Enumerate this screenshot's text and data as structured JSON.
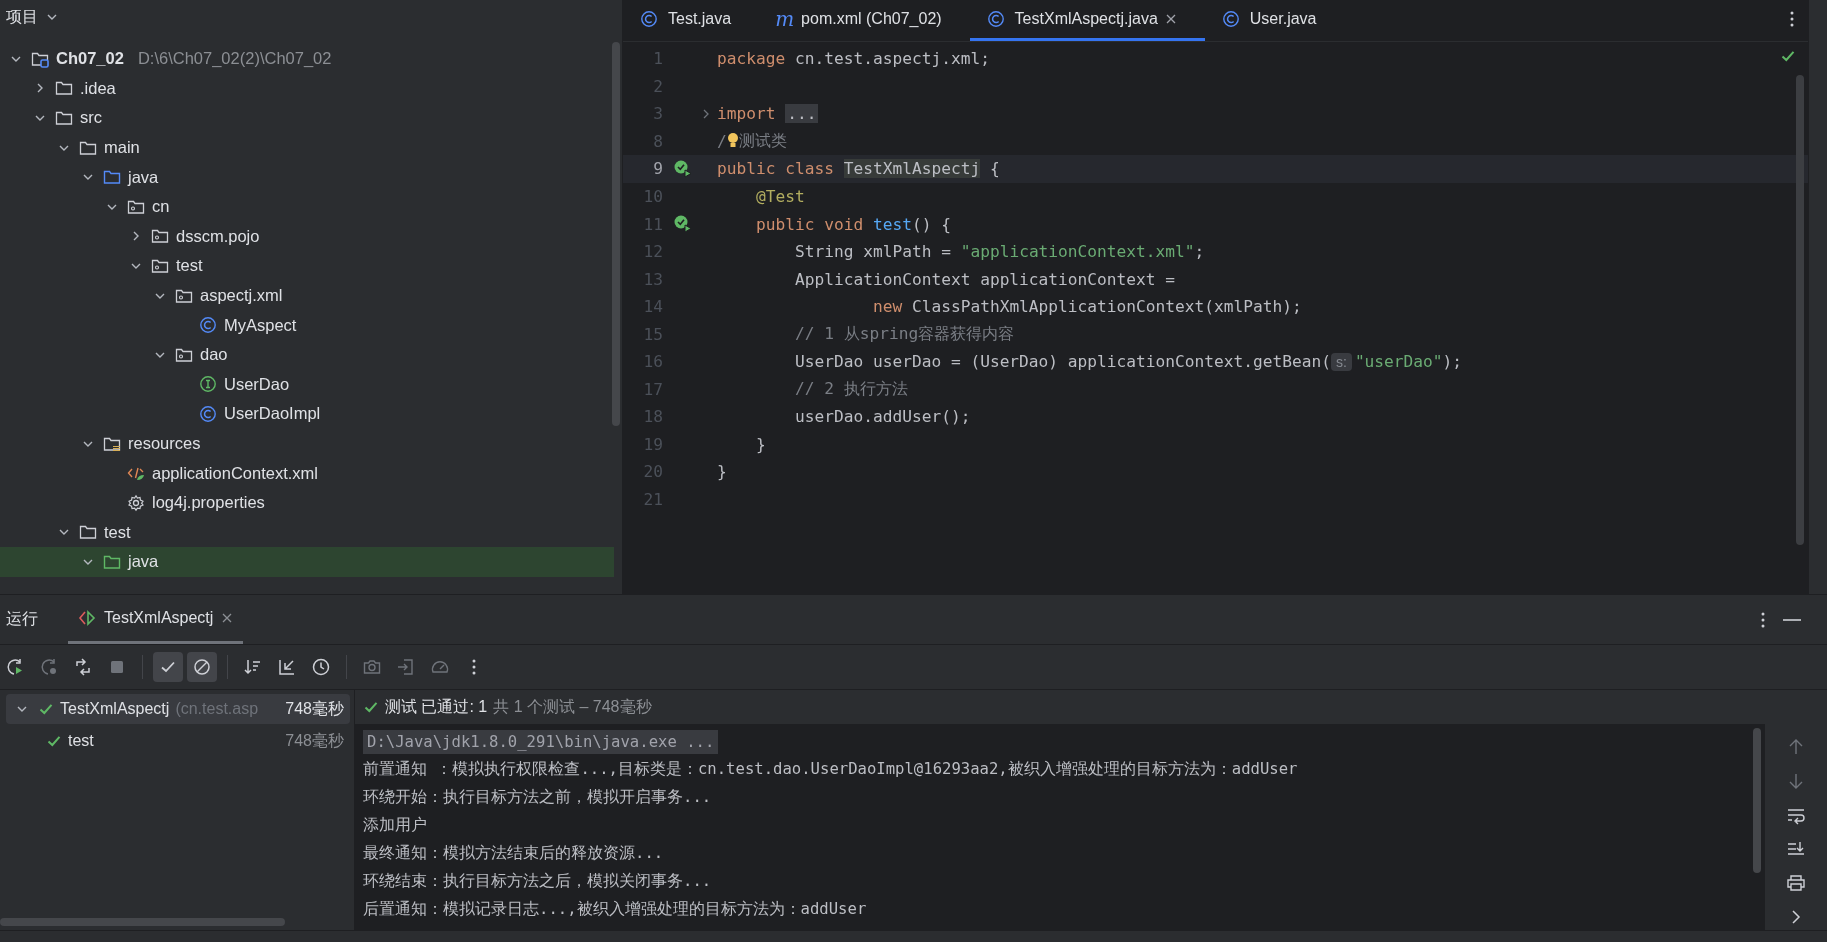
{
  "project_panel": {
    "title": "项目",
    "tree": [
      {
        "name": "Ch07_02",
        "path": "D:\\6\\Ch07_02(2)\\Ch07_02",
        "kind": "module",
        "expanded": true,
        "selected": false,
        "children": [
          {
            "name": ".idea",
            "kind": "folder",
            "expanded": false,
            "selected": false
          },
          {
            "name": "src",
            "kind": "folder",
            "expanded": true,
            "selected": false,
            "children": [
              {
                "name": "main",
                "kind": "folder",
                "expanded": true,
                "selected": false,
                "children": [
                  {
                    "name": "java",
                    "kind": "source",
                    "expanded": true,
                    "selected": false,
                    "children": [
                      {
                        "name": "cn",
                        "kind": "package",
                        "expanded": true,
                        "selected": false,
                        "children": [
                          {
                            "name": "dsscm.pojo",
                            "kind": "package",
                            "expanded": false,
                            "selected": false
                          },
                          {
                            "name": "test",
                            "kind": "package",
                            "expanded": true,
                            "selected": false,
                            "children": [
                              {
                                "name": "aspectj.xml",
                                "kind": "package",
                                "expanded": true,
                                "selected": false,
                                "children": [
                                  {
                                    "name": "MyAspect",
                                    "kind": "class",
                                    "selected": false
                                  }
                                ]
                              },
                              {
                                "name": "dao",
                                "kind": "package",
                                "expanded": true,
                                "selected": false,
                                "children": [
                                  {
                                    "name": "UserDao",
                                    "kind": "interface",
                                    "selected": false
                                  },
                                  {
                                    "name": "UserDaoImpl",
                                    "kind": "class",
                                    "selected": false
                                  }
                                ]
                              }
                            ]
                          }
                        ]
                      }
                    ]
                  },
                  {
                    "name": "resources",
                    "kind": "resources",
                    "expanded": true,
                    "selected": false,
                    "children": [
                      {
                        "name": "applicationContext.xml",
                        "kind": "xml",
                        "selected": false
                      },
                      {
                        "name": "log4j.properties",
                        "kind": "properties",
                        "selected": false
                      }
                    ]
                  }
                ]
              },
              {
                "name": "test",
                "kind": "folder",
                "expanded": true,
                "selected": false,
                "children": [
                  {
                    "name": "java",
                    "kind": "test-source",
                    "expanded": true,
                    "selected": true
                  }
                ]
              }
            ]
          }
        ]
      }
    ]
  },
  "editor": {
    "tabs": [
      {
        "label": "Test.java",
        "kind": "class",
        "selected": false
      },
      {
        "label": "pom.xml (Ch07_02)",
        "kind": "maven",
        "glyph": "m",
        "selected": false
      },
      {
        "label": "TestXmlAspectj.java",
        "kind": "class",
        "selected": true
      },
      {
        "label": "User.java",
        "kind": "class",
        "selected": false
      }
    ],
    "lines": [
      {
        "number": "1",
        "current": false,
        "kind": "code",
        "tokens": [
          {
            "text": "package",
            "kind": "keyword"
          },
          {
            "text": " cn.test.aspectj.xml;",
            "kind": "plain"
          }
        ]
      },
      {
        "number": "2",
        "current": false,
        "kind": "code"
      },
      {
        "number": "3",
        "current": false,
        "kind": "fold",
        "tokens": [
          {
            "text": "import ",
            "kind": "keyword"
          },
          {
            "text": "...",
            "kind": "folded"
          }
        ]
      },
      {
        "number": "8",
        "current": false,
        "kind": "code",
        "tokens": [
          {
            "text": "/",
            "kind": "comment"
          },
          {
            "kind": "bulb"
          },
          {
            "text": "测试类",
            "kind": "comment"
          }
        ]
      },
      {
        "number": "9",
        "current": true,
        "kind": "run",
        "tokens": [
          {
            "text": "public class ",
            "kind": "keyword"
          },
          {
            "text": "TestXmlAspectj",
            "kind": "usage"
          },
          {
            "text": " {",
            "kind": "plain"
          }
        ]
      },
      {
        "number": "10",
        "current": false,
        "kind": "code",
        "tokens": [
          {
            "text": "    @Test",
            "kind": "annotation"
          }
        ]
      },
      {
        "number": "11",
        "current": false,
        "kind": "run",
        "tokens": [
          {
            "text": "    public void ",
            "kind": "keyword"
          },
          {
            "text": "test",
            "kind": "method"
          },
          {
            "text": "() {",
            "kind": "plain"
          }
        ]
      },
      {
        "number": "12",
        "current": false,
        "kind": "code",
        "tokens": [
          {
            "text": "        String xmlPath = ",
            "kind": "plain"
          },
          {
            "text": "\"applicationContext.xml\"",
            "kind": "string"
          },
          {
            "text": ";",
            "kind": "plain"
          }
        ]
      },
      {
        "number": "13",
        "current": false,
        "kind": "code",
        "tokens": [
          {
            "text": "        ApplicationContext applicationContext =",
            "kind": "plain"
          }
        ]
      },
      {
        "number": "14",
        "current": false,
        "kind": "code",
        "tokens": [
          {
            "text": "                new ",
            "kind": "keyword"
          },
          {
            "text": "ClassPathXmlApplicationContext(xmlPath);",
            "kind": "plain"
          }
        ]
      },
      {
        "number": "15",
        "current": false,
        "kind": "code",
        "tokens": [
          {
            "text": "        // 1 从spring容器获得内容",
            "kind": "comment"
          }
        ]
      },
      {
        "number": "16",
        "current": false,
        "kind": "code",
        "tokens": [
          {
            "text": "        UserDao userDao = (UserDao) applicationContext.getBean(",
            "kind": "plain"
          },
          {
            "text": "s:",
            "kind": "hint"
          },
          {
            "text": "\"userDao\"",
            "kind": "string"
          },
          {
            "text": ");",
            "kind": "plain"
          }
        ]
      },
      {
        "number": "17",
        "current": false,
        "kind": "code",
        "tokens": [
          {
            "text": "        // 2 执行方法",
            "kind": "comment"
          }
        ]
      },
      {
        "number": "18",
        "current": false,
        "kind": "code",
        "tokens": [
          {
            "text": "        userDao.addUser();",
            "kind": "plain"
          }
        ]
      },
      {
        "number": "19",
        "current": false,
        "kind": "code",
        "tokens": [
          {
            "text": "    }",
            "kind": "plain"
          }
        ]
      },
      {
        "number": "20",
        "current": false,
        "kind": "code",
        "tokens": [
          {
            "text": "}",
            "kind": "plain"
          }
        ]
      },
      {
        "number": "21",
        "current": false,
        "kind": "code"
      }
    ]
  },
  "run_panel": {
    "title": "运行",
    "tabs": [
      {
        "label": "TestXmlAspectj",
        "selected": true
      }
    ],
    "toolbar": [
      {
        "kind": "rerun",
        "on": false,
        "disabled": false
      },
      {
        "kind": "rerun-failed",
        "on": false,
        "disabled": true
      },
      {
        "kind": "auto-test",
        "on": false,
        "disabled": false
      },
      {
        "kind": "stop",
        "on": false,
        "disabled": true
      },
      {
        "kind": "show-passed",
        "on": true,
        "disabled": false
      },
      {
        "kind": "show-ignored",
        "on": true,
        "disabled": false
      },
      {
        "kind": "sort",
        "on": false,
        "disabled": false
      },
      {
        "kind": "collapse",
        "on": false,
        "disabled": false
      },
      {
        "kind": "history",
        "on": false,
        "disabled": false
      },
      {
        "kind": "screenshot",
        "on": false,
        "disabled": true
      },
      {
        "kind": "export",
        "on": false,
        "disabled": true
      },
      {
        "kind": "gauge",
        "on": false,
        "disabled": true
      },
      {
        "kind": "more",
        "on": false,
        "disabled": false
      }
    ],
    "tests": [
      {
        "name": "TestXmlAspectj",
        "detail": "(cn.test.asp",
        "time": "748毫秒",
        "passed": true,
        "selected": true,
        "expanded": true,
        "children": [
          {
            "name": "test",
            "time": "748毫秒",
            "passed": true,
            "selected": false
          }
        ]
      }
    ],
    "status": {
      "passed": true,
      "label": "测试 已通过: 1",
      "summary": "共 1 个测试 – 748毫秒"
    },
    "console": [
      {
        "kind": "command",
        "text": "D:\\Java\\jdk1.8.0_291\\bin\\java.exe ..."
      },
      {
        "kind": "output",
        "text": "前置通知 ：模拟执行权限检查...,目标类是：cn.test.dao.UserDaoImpl@16293aa2,被织入增强处理的目标方法为：addUser"
      },
      {
        "kind": "output",
        "text": "环绕开始：执行目标方法之前，模拟开启事务..."
      },
      {
        "kind": "output",
        "text": "添加用户"
      },
      {
        "kind": "output",
        "text": "最终通知：模拟方法结束后的释放资源..."
      },
      {
        "kind": "output",
        "text": "环绕结束：执行目标方法之后，模拟关闭事务..."
      },
      {
        "kind": "output",
        "text": "后置通知：模拟记录日志...,被织入增强处理的目标方法为：addUser"
      }
    ],
    "console_tools": [
      {
        "kind": "up",
        "disabled": true
      },
      {
        "kind": "down",
        "disabled": true
      },
      {
        "kind": "wrap",
        "disabled": false
      },
      {
        "kind": "scroll-end",
        "disabled": false
      },
      {
        "kind": "print",
        "disabled": false
      },
      {
        "kind": "expand",
        "disabled": false
      }
    ]
  }
}
